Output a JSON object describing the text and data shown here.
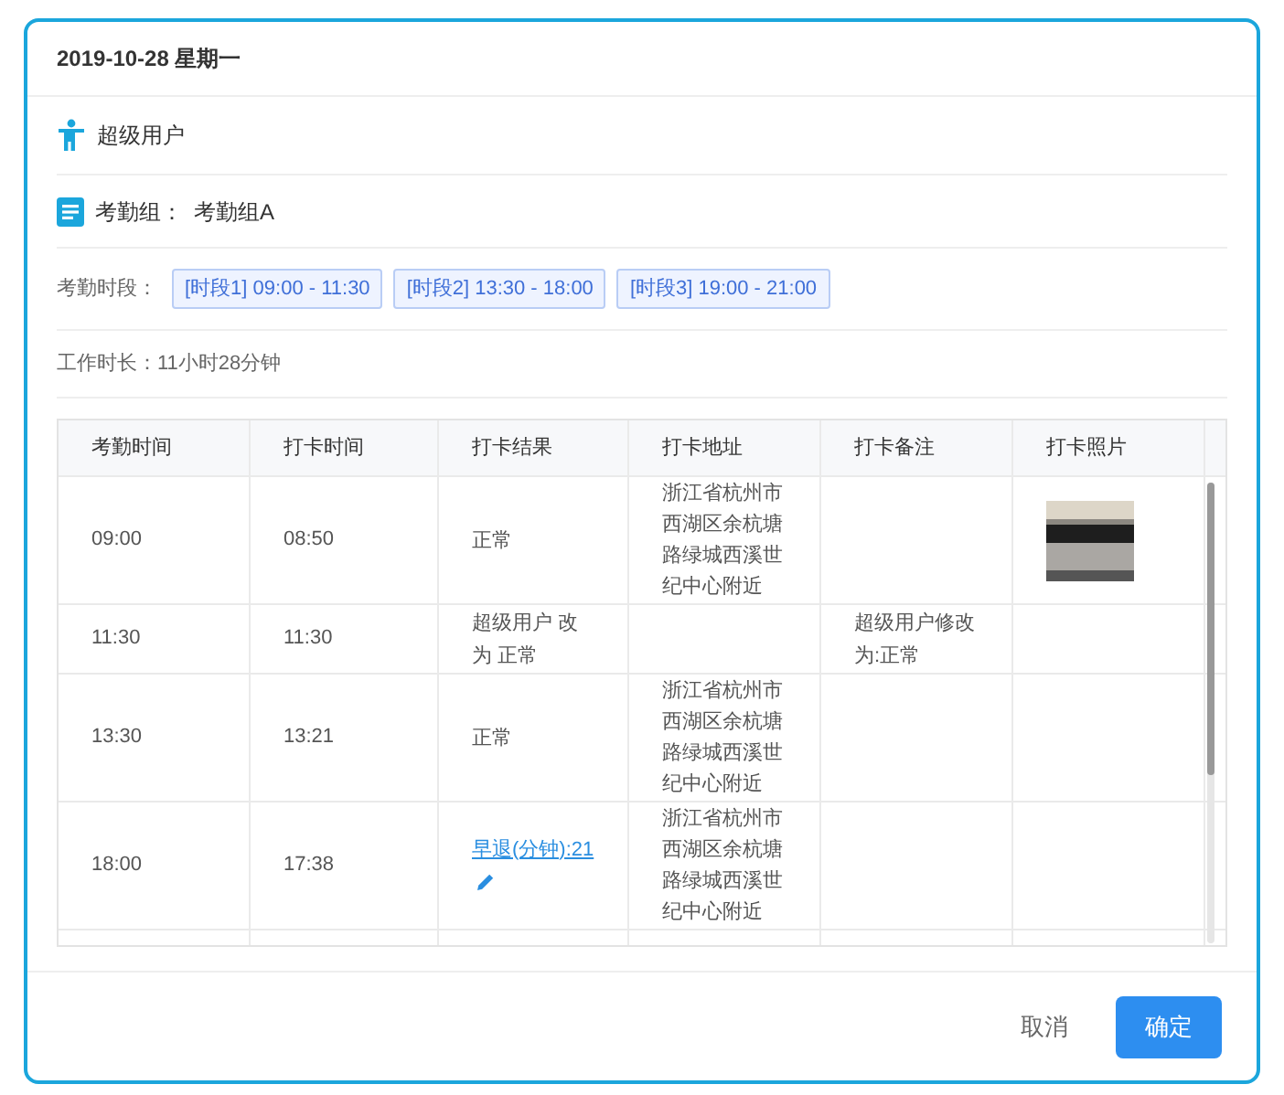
{
  "dialog": {
    "title": "2019-10-28 星期一"
  },
  "user": {
    "name": "超级用户"
  },
  "group": {
    "label": "考勤组：",
    "value": "考勤组A"
  },
  "periods": {
    "label": "考勤时段：",
    "tags": [
      "[时段1] 09:00 - 11:30",
      "[时段2] 13:30 - 18:00",
      "[时段3] 19:00 - 21:00"
    ]
  },
  "work_duration": {
    "label": "工作时长：",
    "value": "11小时28分钟"
  },
  "table": {
    "columns": [
      "考勤时间",
      "打卡时间",
      "打卡结果",
      "打卡地址",
      "打卡备注",
      "打卡照片"
    ],
    "rows": [
      {
        "scheduled": "09:00",
        "clocked": "08:50",
        "result": {
          "kind": "text",
          "text": "正常"
        },
        "address": "浙江省杭州市西湖区余杭塘路绿城西溪世纪中心附近"
      },
      {
        "scheduled": "11:30",
        "clocked": "11:30",
        "result": {
          "kind": "text",
          "text": "超级用户 改为 正常"
        },
        "note": "超级用户修改为:正常"
      },
      {
        "scheduled": "13:30",
        "clocked": "13:21",
        "result": {
          "kind": "text",
          "text": "正常"
        },
        "address": "浙江省杭州市西湖区余杭塘路绿城西溪世纪中心附近"
      },
      {
        "scheduled": "18:00",
        "clocked": "17:38",
        "result": {
          "kind": "link",
          "text": "早退(分钟):21"
        },
        "address": "浙江省杭州市西湖区余杭塘路绿城西溪世纪中心附近"
      }
    ]
  },
  "buttons": [
    {
      "kind": "plain",
      "label": "取消"
    },
    {
      "kind": "primary",
      "label": "确定"
    }
  ]
}
